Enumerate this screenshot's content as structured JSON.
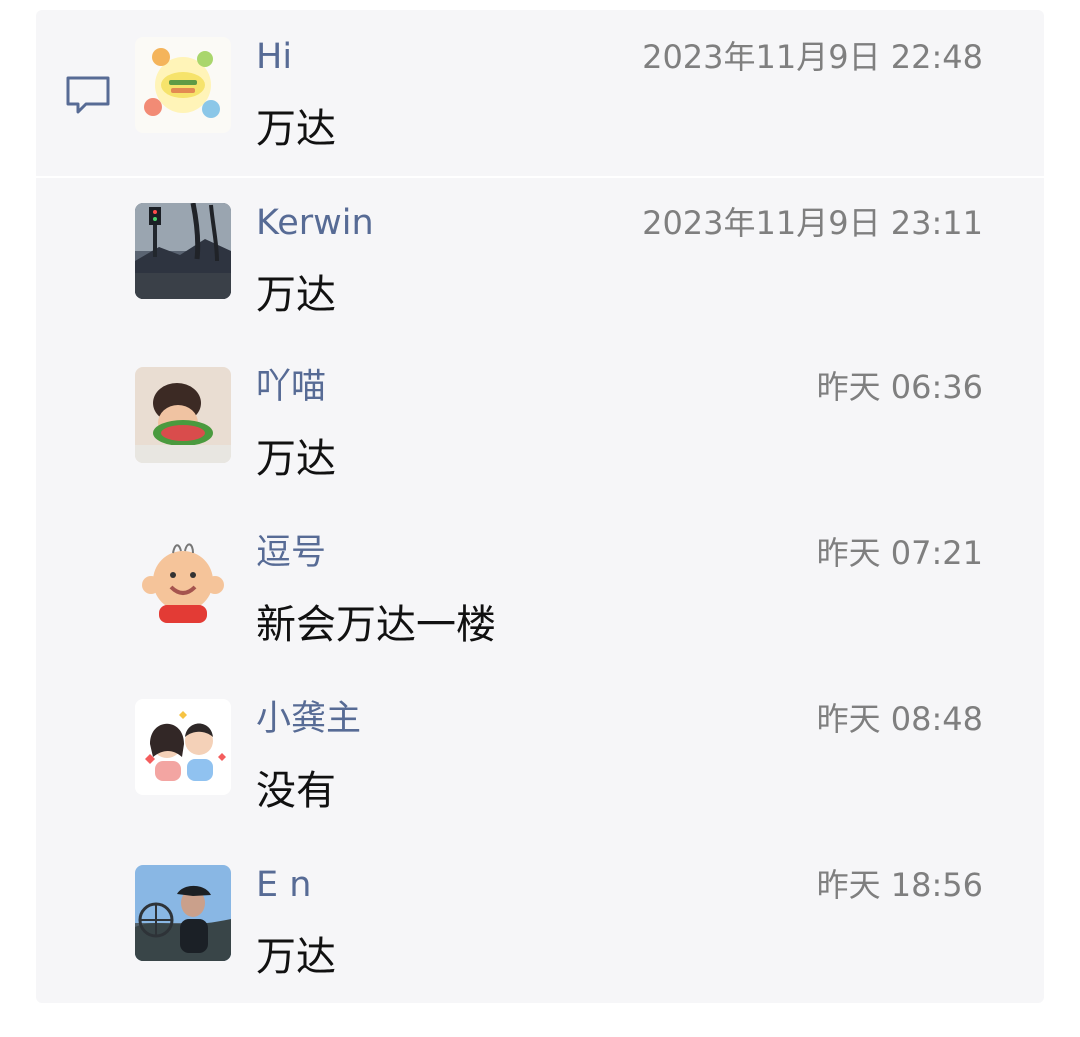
{
  "comments": [
    {
      "name": "Hi",
      "time": "2023年11月9日 22:48",
      "text": "万达",
      "avatar": "baby-sticker-avatar"
    },
    {
      "name": "Kerwin",
      "time": "2023年11月9日 23:11",
      "text": "万达",
      "avatar": "street-photo-avatar"
    },
    {
      "name": "吖喵",
      "time": "昨天 06:36",
      "text": "万达",
      "avatar": "child-watermelon-avatar"
    },
    {
      "name": "逗号",
      "time": "昨天 07:21",
      "text": "新会万达一楼",
      "avatar": "cartoon-baby-avatar"
    },
    {
      "name": "小龚主",
      "time": "昨天 08:48",
      "text": "没有",
      "avatar": "cartoon-couple-avatar"
    },
    {
      "name": "E n",
      "time": "昨天 18:56",
      "text": "万达",
      "avatar": "person-photo-avatar"
    }
  ],
  "icons": {
    "comment": "comment-bubble-icon"
  },
  "colors": {
    "name": "#576b95",
    "time": "#7f7f7f",
    "text": "#111111",
    "panel": "#f6f6f8"
  }
}
